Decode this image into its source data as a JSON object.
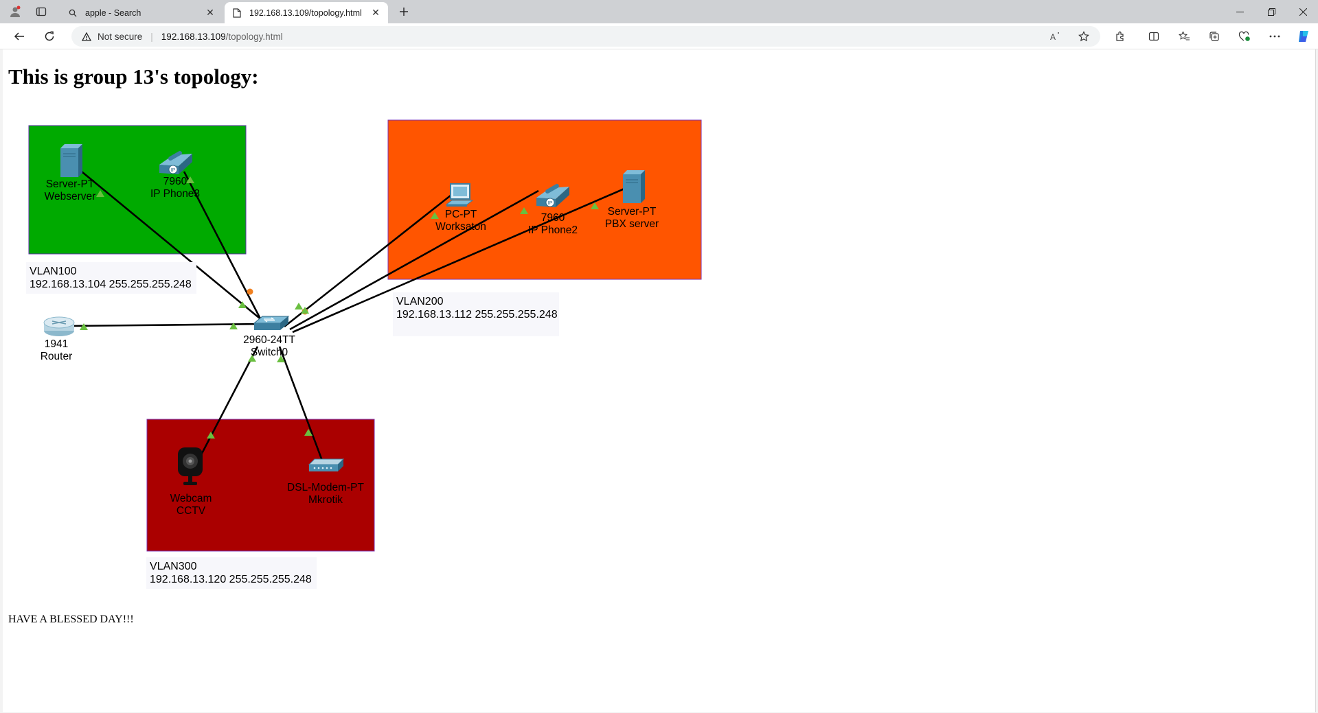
{
  "browser": {
    "tabs": [
      {
        "title": "apple - Search",
        "active": false
      },
      {
        "title": "192.168.13.109/topology.html",
        "active": true
      }
    ],
    "address": {
      "security_label": "Not secure",
      "url_host": "192.168.13.109",
      "url_path": "/topology.html"
    }
  },
  "page": {
    "title": "This is group 13's topology:",
    "footer": "HAVE A BLESSED DAY!!!"
  },
  "topology": {
    "vlans": [
      {
        "name": "VLAN100",
        "subnet": "192.168.13.104 255.255.255.248",
        "color": "#00aa00"
      },
      {
        "name": "VLAN200",
        "subnet": "192.168.13.112 255.255.255.248",
        "color": "#ff5500"
      },
      {
        "name": "VLAN300",
        "subnet": "192.168.13.120 255.255.255.248",
        "color": "#aa0000"
      }
    ],
    "devices": {
      "webserver": {
        "model": "Server-PT",
        "name": "Webserver"
      },
      "ipphone3": {
        "model": "7960",
        "name": "IP Phone3"
      },
      "worksaton": {
        "model": "PC-PT",
        "name": "Worksaton"
      },
      "ipphone2": {
        "model": "7960",
        "name": "IP Phone2"
      },
      "pbx": {
        "model": "Server-PT",
        "name": "PBX server"
      },
      "router": {
        "model": "1941",
        "name": "Router"
      },
      "switch": {
        "model": "2960-24TT",
        "name": "Switch0"
      },
      "webcam": {
        "model": "Webcam",
        "name": "CCTV"
      },
      "modem": {
        "model": "DSL-Modem-PT",
        "name": "Mkrotik"
      }
    },
    "link_up_color": "#6abf40",
    "link_pending_color": "#f08020"
  }
}
